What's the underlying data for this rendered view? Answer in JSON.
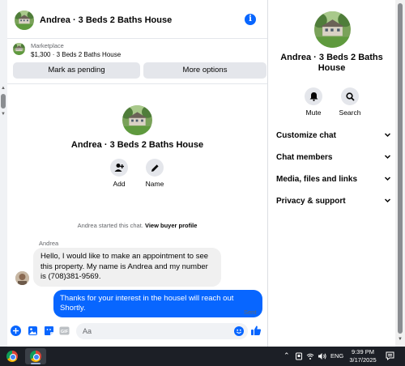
{
  "conversation": {
    "title": "Andrea · 3 Beds 2 Baths House"
  },
  "listing": {
    "label": "Marketplace",
    "summary": "$1,300 · 3 Beds 2 Baths House",
    "mark_pending_label": "Mark as pending",
    "more_options_label": "More options"
  },
  "profile": {
    "title": "Andrea · 3 Beds 2 Baths House",
    "add_label": "Add",
    "name_label": "Name"
  },
  "thread": {
    "started_prefix": "Andrea started this chat.",
    "started_link": "View buyer profile",
    "messages": [
      {
        "sender": "Andrea",
        "text": "Hello, I would like to make an appointment to see this property. My name is Andrea and my number is (708)381-9569."
      },
      {
        "text": "Thanks for your interest in the housel will reach out Shortly.",
        "status": "Sent"
      }
    ]
  },
  "composer": {
    "placeholder": "Aa"
  },
  "info_panel": {
    "title": "Andrea · 3 Beds 2 Baths House",
    "mute_label": "Mute",
    "search_label": "Search",
    "sections": [
      {
        "label": "Customize chat"
      },
      {
        "label": "Chat members"
      },
      {
        "label": "Media, files and links"
      },
      {
        "label": "Privacy & support"
      }
    ]
  },
  "taskbar": {
    "language": "ENG",
    "time": "9:39 PM",
    "date": "3/17/2025"
  },
  "colors": {
    "accent": "#0866ff",
    "bubble_in": "#f0f0f0",
    "button_bg": "#e4e6eb"
  }
}
